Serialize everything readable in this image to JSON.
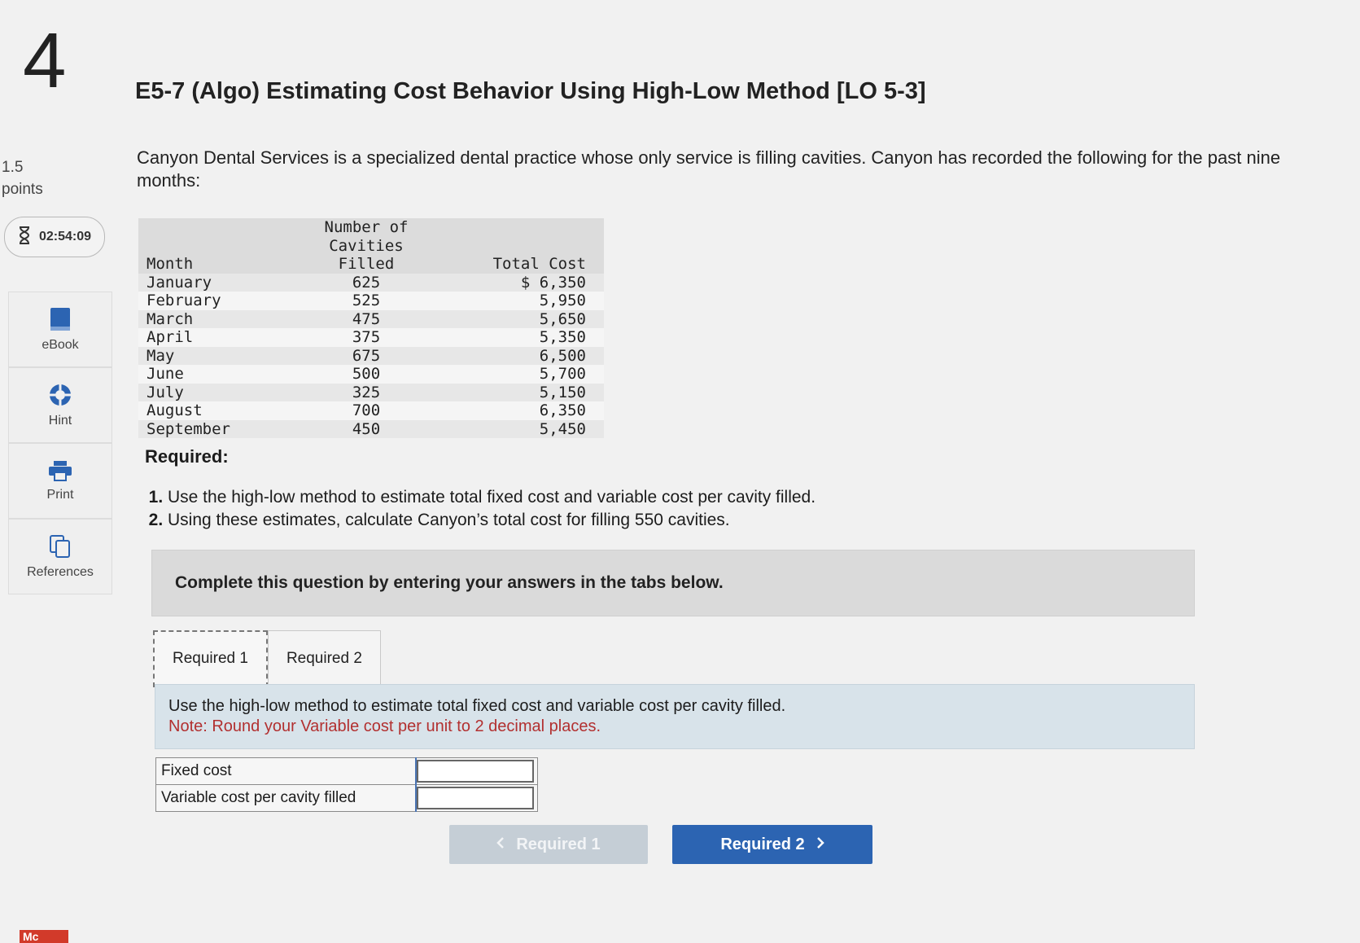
{
  "question": {
    "number": "4",
    "points_value": "1.5",
    "points_label": "points",
    "timer": "02:54:09",
    "title": "E5-7 (Algo) Estimating Cost Behavior Using High-Low Method [LO 5-3]",
    "intro": "Canyon Dental Services is a specialized dental practice whose only service is filling cavities. Canyon has recorded the following for the past nine months:"
  },
  "tools": [
    {
      "label": "eBook",
      "icon": "book-icon"
    },
    {
      "label": "Hint",
      "icon": "lifebuoy-icon"
    },
    {
      "label": "Print",
      "icon": "printer-icon"
    },
    {
      "label": "References",
      "icon": "copy-icon"
    }
  ],
  "data_table": {
    "headers": {
      "month": "Month",
      "cavities_line1": "Number of Cavities",
      "cavities_line2": "Filled",
      "total_cost": "Total Cost"
    },
    "rows": [
      {
        "month": "January",
        "cavities": "625",
        "cost": "$ 6,350"
      },
      {
        "month": "February",
        "cavities": "525",
        "cost": "5,950"
      },
      {
        "month": "March",
        "cavities": "475",
        "cost": "5,650"
      },
      {
        "month": "April",
        "cavities": "375",
        "cost": "5,350"
      },
      {
        "month": "May",
        "cavities": "675",
        "cost": "6,500"
      },
      {
        "month": "June",
        "cavities": "500",
        "cost": "5,700"
      },
      {
        "month": "July",
        "cavities": "325",
        "cost": "5,150"
      },
      {
        "month": "August",
        "cavities": "700",
        "cost": "6,350"
      },
      {
        "month": "September",
        "cavities": "450",
        "cost": "5,450"
      }
    ]
  },
  "required": {
    "heading": "Required:",
    "items": [
      "Use the high-low method to estimate total fixed cost and variable cost per cavity filled.",
      "Using these estimates, calculate Canyon’s total cost for filling 550 cavities."
    ]
  },
  "banner": "Complete this question by entering your answers in the tabs below.",
  "tabs": [
    "Required 1",
    "Required 2"
  ],
  "instructions": {
    "text": "Use the high-low method to estimate total fixed cost and variable cost per cavity filled.",
    "note": "Note: Round your Variable cost per unit to 2 decimal places."
  },
  "answer_rows": [
    {
      "label": "Fixed cost",
      "value": ""
    },
    {
      "label": "Variable cost per cavity filled",
      "value": ""
    }
  ],
  "nav": {
    "prev_label": "Required 1",
    "next_label": "Required 2"
  },
  "colors": {
    "next_button": "#2c64b2",
    "prev_button_disabled": "#c5ced6",
    "note_text": "#b23030",
    "instructions_bg": "#d8e3ea"
  },
  "logo_text": "Mc"
}
